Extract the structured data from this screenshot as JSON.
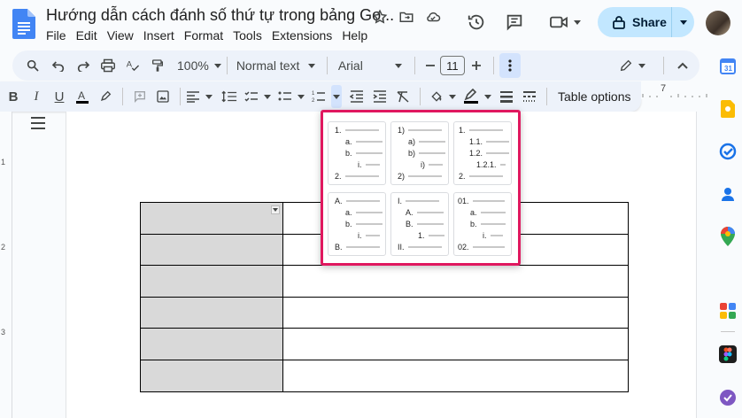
{
  "doc": {
    "title": "Hướng dẫn cách đánh số thứ tự trong bảng Go...",
    "menus": [
      "File",
      "Edit",
      "View",
      "Insert",
      "Format",
      "Tools",
      "Extensions",
      "Help"
    ]
  },
  "header": {
    "share_label": "Share"
  },
  "toolbar": {
    "zoom": "100%",
    "style": "Normal text",
    "font": "Arial",
    "font_size": "11",
    "table_options_label": "Table options",
    "ruler_label": "7"
  },
  "ruler_left": [
    "1",
    "2",
    "3"
  ],
  "numbered_list_presets": [
    {
      "name": "decimal-alpha-roman",
      "lines": [
        "1.",
        "a.",
        "b.",
        "i.",
        "2."
      ]
    },
    {
      "name": "paren-style",
      "lines": [
        "1)",
        "a)",
        "b)",
        "i)",
        "2)"
      ]
    },
    {
      "name": "hierarchical-decimal",
      "lines": [
        "1.",
        "1.1.",
        "1.2.",
        "1.2.1.",
        "2."
      ]
    },
    {
      "name": "upper-alpha",
      "lines": [
        "A.",
        "a.",
        "b.",
        "i.",
        "B."
      ]
    },
    {
      "name": "upper-roman",
      "lines": [
        "I.",
        "A.",
        "B.",
        "1.",
        "II."
      ]
    },
    {
      "name": "leading-zero",
      "lines": [
        "01.",
        "a.",
        "b.",
        "i.",
        "02."
      ]
    }
  ],
  "table": {
    "rows": 6,
    "cols": 2
  },
  "colors": {
    "accent": "#e0185f",
    "share_bg": "#c2e7ff",
    "toolbar_bg": "#edf2fa",
    "cell_shade": "#d9d9d9",
    "docs_blue": "#4285f4"
  },
  "side_panel": [
    "calendar-icon",
    "keep-icon",
    "tasks-icon",
    "contacts-icon",
    "maps-icon",
    "addon-icon",
    "figma-icon",
    "addon-purple-icon"
  ]
}
